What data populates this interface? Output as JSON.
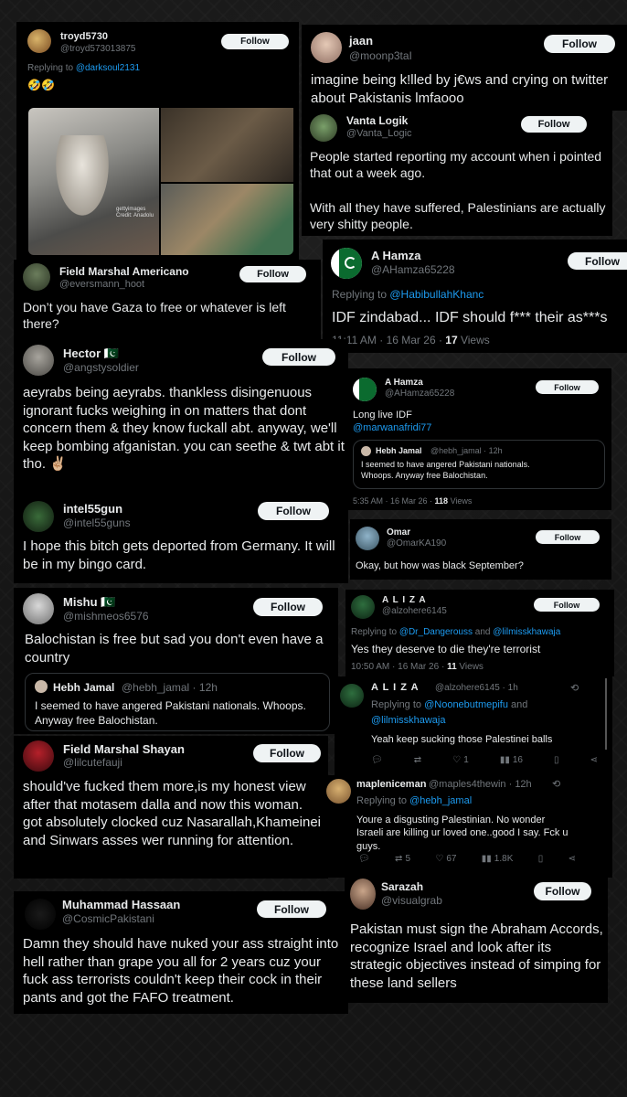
{
  "follow_label": "Follow",
  "cards": {
    "troyd": {
      "name": "troyd5730",
      "handle": "@troyd573013875",
      "replying_prefix": "Replying to ",
      "replying_user": "@darksoul2131",
      "body": "🤣🤣",
      "photo_caption": "gettyimages Credit: Anadolu"
    },
    "jaan": {
      "name": "jaan",
      "handle": "@moonp3taI",
      "body": "imagine being k!lled by j€ws and crying on twitter about Pakistanis lmfaooo"
    },
    "vanta": {
      "name": "Vanta Logik",
      "handle": "@Vanta_Logic",
      "body1": "People started reporting my account when i pointed that out a week ago.",
      "body2": "With all they have suffered, Palestinians are actually very shitty people."
    },
    "fma": {
      "name": "Field Marshal Americano",
      "handle": "@eversmann_hoot",
      "body": "Don’t you have Gaza to free or whatever is left there?"
    },
    "hamza_big": {
      "name": "A Hamza",
      "handle": "@AHamza65228",
      "replying_prefix": "Replying to ",
      "replying_user": "@HabibullahKhanc",
      "body": "IDF zindabad... IDF should f*** their as***s",
      "time": "11:11 AM · 16 Mar 26 · ",
      "views_num": "17",
      "views_label": " Views"
    },
    "hector": {
      "name": "Hector 🇵🇰",
      "handle": "@angstysoldier",
      "body": "aeyrabs being aeyrabs. thankless disingenuous ignorant fucks weighing in on matters that dont concern them & they know fuckall abt. anyway, we'll keep bombing afganistan. you can seethe & twt abt it tho. ✌🏼"
    },
    "hamza_small": {
      "name": "A Hamza",
      "handle": "@AHamza65228",
      "body": "Long live IDF",
      "mention": "@marwanafridi77",
      "quote_name": "Hebh Jamal",
      "quote_meta": "@hebh_jamal · 12h",
      "quote_body": "I seemed to have angered Pakistani nationals. Whoops. Anyway free Balochistan.",
      "time": "5:35 AM · 16 Mar 26 · ",
      "views_num": "118",
      "views_label": " Views"
    },
    "intel": {
      "name": "intel55gun",
      "handle": "@intel55guns",
      "body": "I hope this bitch gets deported from Germany. It will be in my bingo card."
    },
    "omar": {
      "name": "Omar",
      "handle": "@OmarKA190",
      "body": "Okay, but how was black September?"
    },
    "mishu": {
      "name": "Mishu 🇵🇰",
      "handle": "@mishmeos6576",
      "body": "Balochistan is free but sad you don't even have a country",
      "quote_name": "Hebh Jamal",
      "quote_meta": "@hebh_jamal · 12h",
      "quote_body": "I seemed to have angered Pakistani nationals. Whoops. Anyway free Balochistan."
    },
    "aliza1": {
      "name": "A L I Z A",
      "handle": "@alzohere6145",
      "replying_prefix": "Replying to ",
      "replying_user1": "@Dr_Dangerouss",
      "replying_and": " and ",
      "replying_user2": "@lilmisskhawaja",
      "body": "Yes they deserve to die they're terrorist",
      "time": "10:50 AM · 16 Mar 26 · ",
      "views_num": "11",
      "views_label": " Views"
    },
    "aliza2": {
      "name": "A L I Z A",
      "handle_time": "@alzohere6145 · 1h",
      "replying_prefix": "Replying to ",
      "replying_user1": "@Noonebutmepifu",
      "replying_and": " and ",
      "replying_user2": "@lilmisskhawaja",
      "body": "Yeah keep sucking those Palestinei balls",
      "likes": "1",
      "views": "16"
    },
    "shayan": {
      "name": "Field Marshal Shayan",
      "handle": "@lilcutefauji",
      "body": "should've fucked them more,is my honest view after that motasem dalla and now this woman. got absolutely clocked cuz Nasarallah,Khameinei and Sinwars asses wer running for attention."
    },
    "mapleniceman": {
      "name": "mapleniceman",
      "handle_time": "@maples4thewin · 12h",
      "replying_prefix": "Replying to ",
      "replying_user": "@hebh_jamal",
      "body": "Youre a disgusting Palestinian. No wonder Israeli are killing ur loved one..good I say. Fck u guys.",
      "retweets": "5",
      "likes": "67",
      "views": "1.8K"
    },
    "hassaan": {
      "name": "Muhammad Hassaan",
      "handle": "@CosmicPakistani",
      "body": "Damn they should have nuked your ass straight into hell rather than grape you all for 2 years cuz your fuck ass terrorists couldn't keep their cock in their pants and got the FAFO treatment."
    },
    "sarazah": {
      "name": "Sarazah",
      "handle": "@visualgrab",
      "body": "Pakistan must sign the Abraham Accords, recognize Israel and look after its strategic objectives instead of simping for these land sellers"
    }
  },
  "icons": {
    "reply": "reply-icon",
    "retweet": "retweet-icon",
    "like": "heart-icon",
    "views": "views-icon",
    "bookmark": "bookmark-icon",
    "share": "share-icon"
  },
  "colors": {
    "background": "#000000",
    "text": "#e7e9ea",
    "secondary": "#71767b",
    "link": "#1d9bf0",
    "follow_bg": "#eff3f4"
  }
}
